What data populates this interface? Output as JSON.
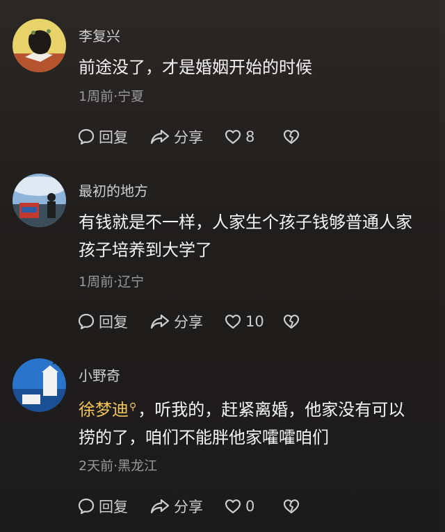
{
  "comments": [
    {
      "username": "李复兴",
      "text": "前途没了，才是婚姻开始的时候",
      "meta": "1周前·宁夏",
      "reply_label": "回复",
      "share_label": "分享",
      "like_count": "8",
      "avatar_icon": "avatar-photo"
    },
    {
      "username": "最初的地方",
      "text": "有钱就是不一样，人家生个孩子钱够普通人家孩子培养到大学了",
      "meta": "1周前·辽宁",
      "reply_label": "回复",
      "share_label": "分享",
      "like_count": "10",
      "avatar_icon": "avatar-photo"
    },
    {
      "username": "小野奇",
      "mention": "徐梦迪",
      "text": "，听我的，赶紧离婚，他家没有可以捞的了，咱们不能胖他家嚯嚯咱们",
      "meta": "2天前·黑龙江",
      "reply_label": "回复",
      "share_label": "分享",
      "like_count": "0",
      "avatar_icon": "avatar-photo"
    }
  ],
  "colors": {
    "background": "#201e1d",
    "mention": "#f2c45a",
    "meta_text": "#9a9a9a"
  },
  "icons": [
    "comment-bubble-icon",
    "share-arrow-icon",
    "heart-icon",
    "broken-heart-icon"
  ]
}
